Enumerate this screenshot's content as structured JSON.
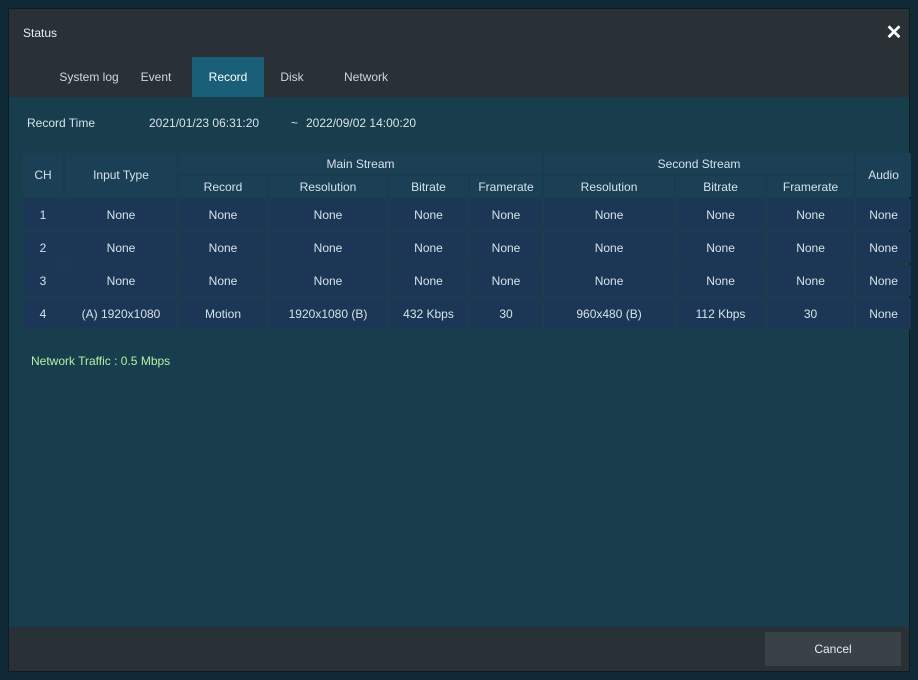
{
  "window": {
    "title": "Status",
    "close_icon": "close-icon"
  },
  "tabs": [
    {
      "label": "System log"
    },
    {
      "label": "Event"
    },
    {
      "label": "Record",
      "active": true
    },
    {
      "label": "Disk"
    },
    {
      "label": "Network"
    }
  ],
  "record_time": {
    "label": "Record Time",
    "start": "2021/01/23 06:31:20",
    "separator": "~",
    "end": "2022/09/02 14:00:20"
  },
  "table": {
    "headers": {
      "ch": "CH",
      "input_type": "Input Type",
      "main_stream": "Main Stream",
      "second_stream": "Second Stream",
      "audio": "Audio",
      "main_sub": [
        "Record",
        "Resolution",
        "Bitrate",
        "Framerate"
      ],
      "second_sub": [
        "Resolution",
        "Bitrate",
        "Framerate"
      ]
    },
    "rows": [
      [
        "1",
        "None",
        "None",
        "None",
        "None",
        "None",
        "None",
        "None",
        "None",
        "None"
      ],
      [
        "2",
        "None",
        "None",
        "None",
        "None",
        "None",
        "None",
        "None",
        "None",
        "None"
      ],
      [
        "3",
        "None",
        "None",
        "None",
        "None",
        "None",
        "None",
        "None",
        "None",
        "None"
      ],
      [
        "4",
        "(A) 1920x1080",
        "Motion",
        "1920x1080 (B)",
        "432 Kbps",
        "30",
        "960x480 (B)",
        "112 Kbps",
        "30",
        "None"
      ]
    ]
  },
  "network_traffic": "Network Traffic :  0.5 Mbps",
  "footer": {
    "cancel_label": "Cancel"
  },
  "colors": {
    "background": "#183d4c",
    "active_tab": "#1a5f78",
    "traffic_text": "#b4f0a8"
  }
}
